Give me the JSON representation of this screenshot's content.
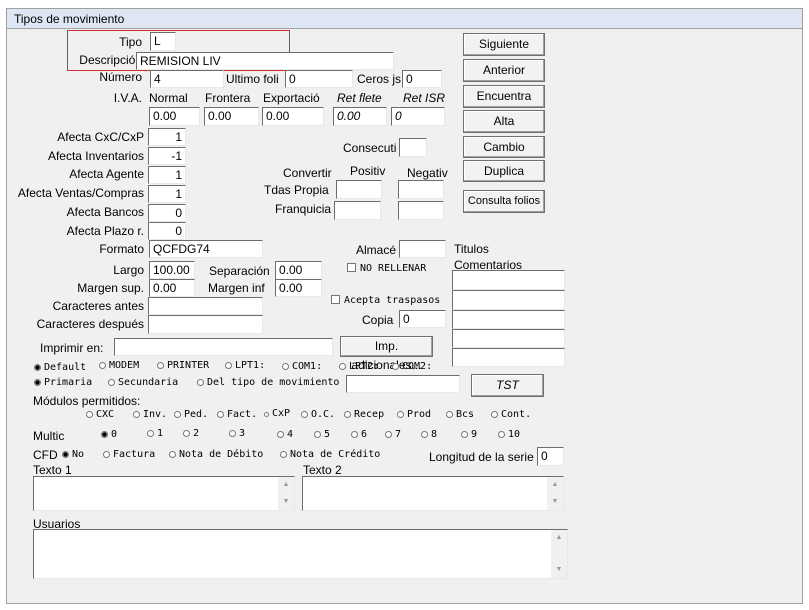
{
  "window": {
    "title": "Tipos de movimiento"
  },
  "fields": {
    "tipo": {
      "label": "Tipo",
      "value": "L"
    },
    "descripcion": {
      "label": "Descripción",
      "value": "REMISION LIV"
    },
    "numero": {
      "label": "Número",
      "value": "4"
    },
    "ultimo_folio": {
      "label": "Ultimo foli",
      "value": "0"
    },
    "ceros": {
      "label": "Ceros js",
      "value": "0"
    }
  },
  "iva": {
    "label": "I.V.A.",
    "headers": [
      "Normal",
      "Fronterа",
      "Exportació",
      "Ret flete",
      "Ret ISR"
    ],
    "values": [
      "0.00",
      "0.00",
      "0.00",
      "0.00",
      "0"
    ]
  },
  "afecta": [
    {
      "label": "Afecta  CxC/CxP",
      "value": "1"
    },
    {
      "label": "Afecta  Inventarios",
      "value": "-1"
    },
    {
      "label": "Afecta  Agente",
      "value": "1"
    },
    {
      "label": "Afecta Ventas/Compras",
      "value": "1"
    },
    {
      "label": "Afecta  Bancos",
      "value": "0"
    },
    {
      "label": "Afecta  Plazo r.",
      "value": "0"
    }
  ],
  "consecutivo": {
    "label": "Consecuti",
    "value": ""
  },
  "convertir": {
    "label": "Convertir",
    "col1": "Positiv",
    "col2": "Negativ",
    "row1": "Tdas Propia",
    "row2": "Franquicia"
  },
  "formato": {
    "label": "Formato",
    "value": "QCFDG74"
  },
  "almacen": {
    "label": "Almacé",
    "value": ""
  },
  "titulos_label": "Titulos",
  "comentarios_label": "Comentarios",
  "largo": {
    "label": "Largo",
    "value": "100.00"
  },
  "separacion": {
    "label": "Separación",
    "value": "0.00"
  },
  "no_rellenar": "NO RELLENAR",
  "margen_sup": {
    "label": "Margen sup.",
    "value": "0.00"
  },
  "margen_inf": {
    "label": "Margen inf",
    "value": "0.00"
  },
  "acepta_traspasos": "Acepta traspasos",
  "caracteres_antes": {
    "label": "Caracteres antes",
    "value": ""
  },
  "caracteres_despues": {
    "label": "Caracteres después",
    "value": ""
  },
  "copia": {
    "label": "Copia",
    "value": "0"
  },
  "imprimir": {
    "label": "Imprimir en:",
    "value": "",
    "adicionales_button": "Imp. adicionales..."
  },
  "printer_options": [
    "Default",
    "MODEM",
    "PRINTER",
    "LPT1:",
    "COM1:",
    "LPT2:",
    "COM2:"
  ],
  "primaria_options": [
    "Primaria",
    "Secundaria",
    "Del tipo de movimiento"
  ],
  "tst_button": "TST",
  "modulos": {
    "label": "Módulos permitidos:",
    "options": [
      "CXC",
      "Inv.",
      "Ped.",
      "Fact.",
      "CxP",
      "O.C.",
      "Recep",
      "Prod",
      "Bcs",
      "Cont."
    ]
  },
  "multic": {
    "label": "Multic",
    "options": [
      "0",
      "1",
      "2",
      "3",
      "4",
      "5",
      "6",
      "7",
      "8",
      "9",
      "10"
    ]
  },
  "cfd": {
    "label": "CFD",
    "options": [
      "No",
      "Factura",
      "Nota de Débito",
      "Nota de Crédito"
    ]
  },
  "longitud_serie": {
    "label": "Longitud de la serie",
    "value": "0"
  },
  "texto1_label": "Texto 1",
  "texto2_label": "Texto 2",
  "usuarios_label": "Usuarios",
  "buttons": [
    "Siguiente",
    "Anterior",
    "Encuentra",
    "Alta",
    "Cambio",
    "Duplica",
    "Consulta folios"
  ]
}
